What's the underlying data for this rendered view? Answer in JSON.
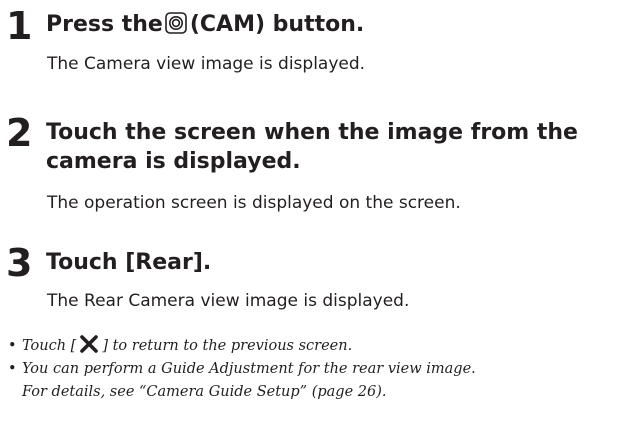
{
  "steps": [
    {
      "number": "1",
      "title_before_icon": "Press the",
      "icon": "camera-button-icon",
      "title_after_icon": "(CAM) button.",
      "description": "The Camera view image is displayed."
    },
    {
      "number": "2",
      "title_line1": "Touch the screen when the image from the",
      "title_line2": "camera is displayed.",
      "description": "The operation screen is displayed on the screen."
    },
    {
      "number": "3",
      "title": "Touch [Rear].",
      "description": "The Rear Camera view image is displayed."
    }
  ],
  "notes": [
    {
      "bullet": "•",
      "text_before_icon": "Touch [",
      "icon": "close-x-icon",
      "text_after_icon": "] to return to the previous screen."
    },
    {
      "bullet": "•",
      "line1": "You can perform a Guide Adjustment for the rear view image.",
      "line2": "For details, see “Camera Guide Setup” (page 26)."
    }
  ]
}
